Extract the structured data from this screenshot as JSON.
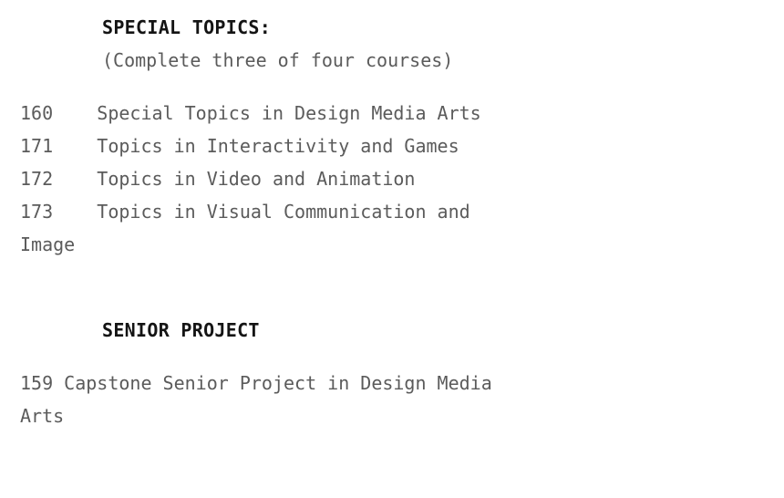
{
  "document": {
    "sections": [
      {
        "id": "special-topics",
        "heading": "SPECIAL TOPICS:",
        "subtitle": "(Complete three of four courses)",
        "entries": [
          {
            "number": "160",
            "title": "Special Topics in Design Media Arts",
            "text": "160    Special Topics in Design Media Arts"
          },
          {
            "number": "171",
            "title": "Topics in Interactivity and Games",
            "text": "171    Topics in Interactivity and Games"
          },
          {
            "number": "172",
            "title": "Topics in Video and Animation",
            "text": "172    Topics in Video and Animation"
          },
          {
            "number": "173",
            "title": "Topics in Visual Communication and Image",
            "text": "173    Topics in Visual Communication and Image"
          }
        ]
      },
      {
        "id": "senior-project",
        "heading": "SENIOR PROJECT",
        "subtitle": "",
        "entries": [
          {
            "number": "159",
            "title": "Capstone Senior Project in Design Media Arts",
            "text": "159 Capstone Senior Project in Design Media Arts"
          }
        ]
      }
    ]
  },
  "style": {
    "background_color": "#ffffff",
    "heading_color": "#141414",
    "body_color": "#5b5b5b"
  }
}
